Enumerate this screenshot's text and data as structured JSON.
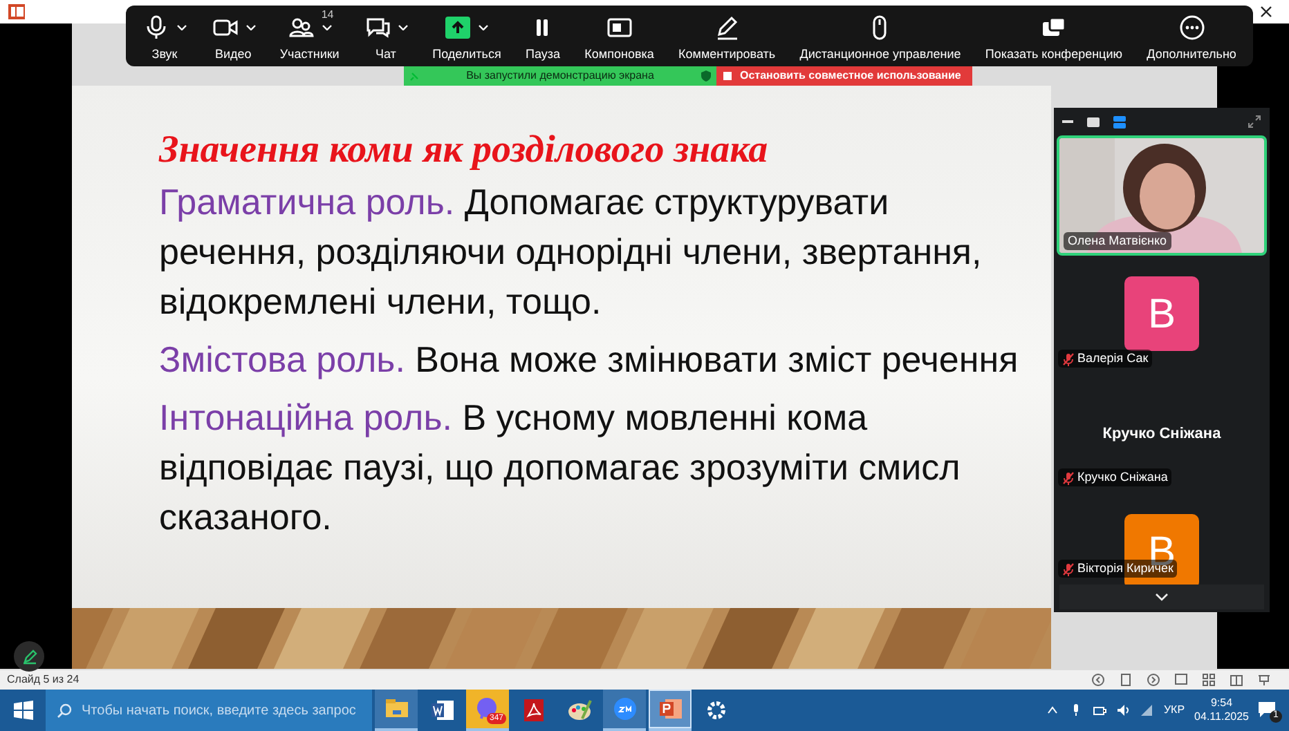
{
  "toolbar": {
    "items": [
      {
        "kind": "mic",
        "label": "Звук",
        "dropdown": true
      },
      {
        "kind": "camera",
        "label": "Видео",
        "dropdown": true
      },
      {
        "kind": "people",
        "label": "Участники",
        "dropdown": true,
        "count": "14"
      },
      {
        "kind": "chat",
        "label": "Чат",
        "dropdown": true
      },
      {
        "kind": "share",
        "label": "Поделиться",
        "dropdown": true
      },
      {
        "kind": "pause",
        "label": "Пауза",
        "dropdown": false
      },
      {
        "kind": "layout",
        "label": "Компоновка",
        "dropdown": false
      },
      {
        "kind": "pen",
        "label": "Комментировать",
        "dropdown": false
      },
      {
        "kind": "mouse",
        "label": "Дистанционное управление",
        "dropdown": false
      },
      {
        "kind": "window",
        "label": "Показать конференцию",
        "dropdown": false
      },
      {
        "kind": "more",
        "label": "Дополнительно",
        "dropdown": false
      }
    ]
  },
  "share_banner": {
    "status": "Вы запустили демонстрацию экрана",
    "stop_button": "Остановить совместное использование"
  },
  "slide": {
    "title": "Значення коми як розділового знака",
    "paragraphs": [
      {
        "heading": "Граматична роль.",
        "text": "Допомагає структурувати речення, розділяючи однорідні члени, звертання, відокремлені члени, тощо."
      },
      {
        "heading": "Змістова роль.",
        "text": "Вона може змінювати зміст речення"
      },
      {
        "heading": "Інтонаційна роль.",
        "text": "В усному мовленні кома відповідає паузі, що допомагає зрозуміти смисл сказаного."
      }
    ]
  },
  "participants_panel": {
    "video_tile": {
      "name": "Олена Матвієнко",
      "speaking": true
    },
    "participants": [
      {
        "kind": "avatar",
        "initial": "В",
        "color": "#e8437a",
        "name": "Валерія Сак",
        "muted": true
      },
      {
        "kind": "name",
        "display": "Кручко Сніжана",
        "name": "Кручко Сніжана",
        "muted": true
      },
      {
        "kind": "avatar",
        "initial": "В",
        "color": "#f07800",
        "name": "Вікторія Киричек",
        "muted": true
      }
    ]
  },
  "status_bar": {
    "slide_counter": "Слайд 5 из 24"
  },
  "taskbar": {
    "search_placeholder": "Чтобы начать поиск, введите здесь запрос",
    "apps": [
      {
        "kind": "folder",
        "open": true,
        "selected": false,
        "flashing": false
      },
      {
        "kind": "word",
        "open": false,
        "selected": false,
        "flashing": false
      },
      {
        "kind": "viber",
        "open": true,
        "selected": false,
        "flashing": true,
        "badge": "347"
      },
      {
        "kind": "pdf",
        "open": false,
        "selected": false,
        "flashing": false
      },
      {
        "kind": "paint",
        "open": false,
        "selected": false,
        "flashing": false
      },
      {
        "kind": "zoom",
        "open": true,
        "selected": false,
        "flashing": false
      },
      {
        "kind": "powerpoint",
        "open": true,
        "selected": true,
        "flashing": false
      },
      {
        "kind": "settings",
        "open": false,
        "selected": false,
        "flashing": false
      }
    ],
    "language": "УКР",
    "time": "9:54",
    "date": "04.11.2025",
    "notifications": "1"
  }
}
